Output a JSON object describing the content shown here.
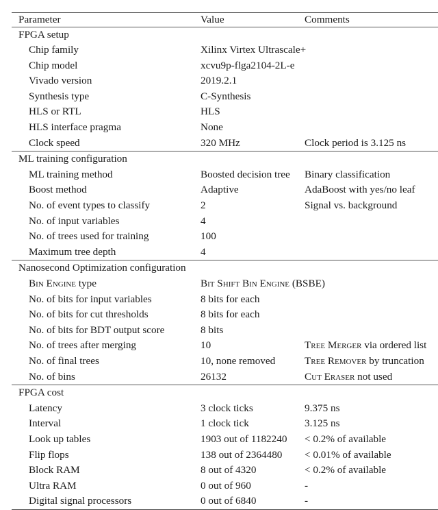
{
  "table": {
    "headers": [
      "Parameter",
      "Value",
      "Comments"
    ],
    "sections": [
      {
        "title": "FPGA setup",
        "rows": [
          {
            "parameter": "Chip family",
            "value": "Xilinx Virtex Ultrascale+",
            "comment": ""
          },
          {
            "parameter": "Chip model",
            "value": "xcvu9p-flga2104-2L-e",
            "comment": ""
          },
          {
            "parameter": "Vivado version",
            "value": "2019.2.1",
            "comment": ""
          },
          {
            "parameter": "Synthesis type",
            "value": "C-Synthesis",
            "comment": ""
          },
          {
            "parameter": "HLS or RTL",
            "value": "HLS",
            "comment": ""
          },
          {
            "parameter": "HLS interface pragma",
            "value": "None",
            "comment": ""
          },
          {
            "parameter": "Clock speed",
            "value": "320 MHz",
            "comment": "Clock period is 3.125 ns"
          }
        ]
      },
      {
        "title": "ML training configuration",
        "rows": [
          {
            "parameter": "ML training method",
            "value": "Boosted decision tree",
            "comment": "Binary classification"
          },
          {
            "parameter": "Boost method",
            "value": "Adaptive",
            "comment": "AdaBoost with yes/no leaf"
          },
          {
            "parameter": "No. of event types to classify",
            "value": "2",
            "comment": "Signal vs. background"
          },
          {
            "parameter": "No. of input variables",
            "value": "4",
            "comment": ""
          },
          {
            "parameter": "No. of trees used for training",
            "value": "100",
            "comment": ""
          },
          {
            "parameter": "Maximum tree depth",
            "value": "4",
            "comment": ""
          }
        ]
      },
      {
        "title": "Nanosecond Optimization configuration",
        "rows": [
          {
            "parameter_sc": "Bin Engine",
            "parameter_rest": " type",
            "value_sc": "Bit Shift Bin Engine",
            "value_rest": " (BSBE)",
            "comment": ""
          },
          {
            "parameter": "No. of bits for input variables",
            "value": "8 bits for each",
            "comment": ""
          },
          {
            "parameter": "No. of bits for cut thresholds",
            "value": "8 bits for each",
            "comment": ""
          },
          {
            "parameter": "No. of bits for BDT output score",
            "value": "8 bits",
            "comment": ""
          },
          {
            "parameter": "No. of trees after merging",
            "value": "10",
            "comment_sc": "Tree Merger",
            "comment_rest": " via ordered list"
          },
          {
            "parameter": "No. of final trees",
            "value": "10, none removed",
            "comment_sc": "Tree Remover",
            "comment_rest": " by truncation"
          },
          {
            "parameter": "No. of bins",
            "value": "26132",
            "comment_sc": "Cut Eraser",
            "comment_rest": " not used"
          }
        ]
      },
      {
        "title": "FPGA cost",
        "rows": [
          {
            "parameter": "Latency",
            "value": "3 clock ticks",
            "comment": "9.375 ns"
          },
          {
            "parameter": "Interval",
            "value": "1 clock tick",
            "comment": "3.125 ns"
          },
          {
            "parameter": "Look up tables",
            "value": "1903 out of 1182240",
            "comment": "< 0.2% of available"
          },
          {
            "parameter": "Flip flops",
            "value": "138 out of 2364480",
            "comment": "< 0.01% of available"
          },
          {
            "parameter": "Block RAM",
            "value": "8 out of 4320",
            "comment": "< 0.2% of available"
          },
          {
            "parameter": "Ultra RAM",
            "value": "0 out of 960",
            "comment": "-"
          },
          {
            "parameter": "Digital signal processors",
            "value": "0 out of 6840",
            "comment": "-"
          }
        ]
      }
    ]
  }
}
